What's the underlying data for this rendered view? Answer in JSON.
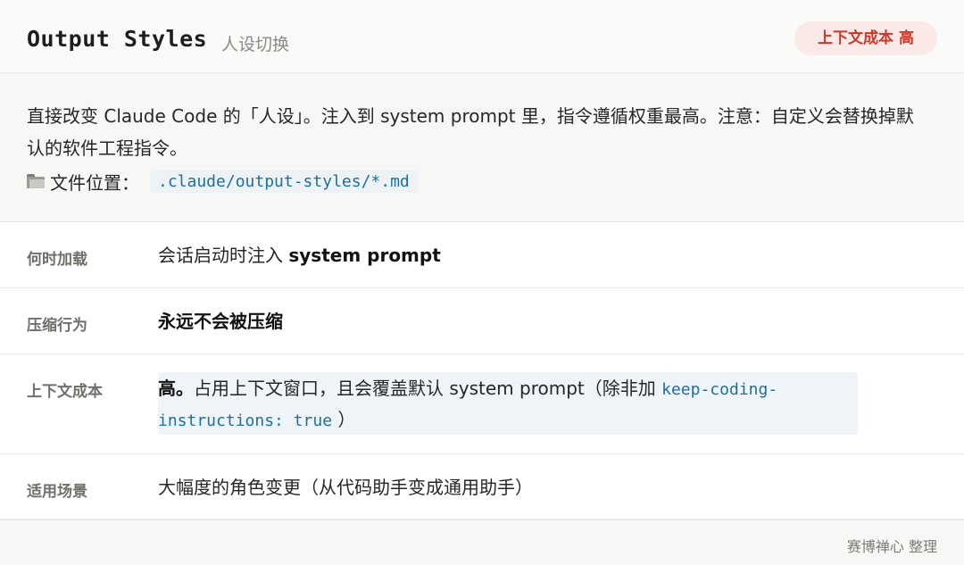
{
  "header": {
    "title": "Output Styles",
    "subtitle": "人设切换",
    "badge": "上下文成本 高"
  },
  "description": {
    "text": "直接改变 Claude Code 的「人设」。注入到 system prompt 里，指令遵循权重最高。注意：自定义会替换掉默认的软件工程指令。",
    "location_icon": "folder-icon",
    "location_label": "文件位置：",
    "location_path": ".claude/output-styles/*.md"
  },
  "rows": {
    "load": {
      "label": "何时加载",
      "value_prefix": "会话启动时注入 ",
      "value_bold": "system prompt"
    },
    "compress": {
      "label": "压缩行为",
      "value_bold": "永远不会被压缩"
    },
    "cost": {
      "label": "上下文成本",
      "value_bold": "高。",
      "value_text": "占用上下文窗口，且会覆盖默认 system prompt（除非加 ",
      "code_part1": "keep-coding-",
      "code_part2": "instructions: true",
      "value_end": " ）"
    },
    "usage": {
      "label": "适用场景",
      "value": "大幅度的角色变更（从代码助手变成通用助手）"
    }
  },
  "footer": {
    "credit": "赛博禅心 整理"
  },
  "colors": {
    "badge_bg": "#fbe9e7",
    "badge_text": "#c9382a",
    "code_text": "#1f6f9c",
    "code_bg": "#eef4f8"
  }
}
